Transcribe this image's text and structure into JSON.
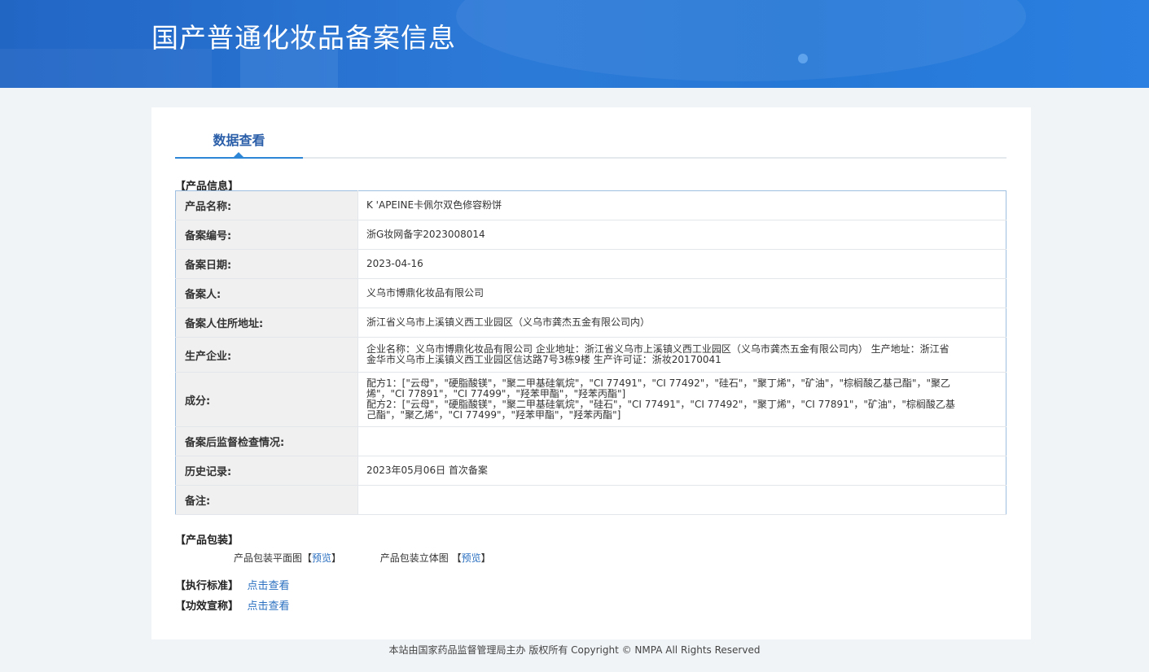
{
  "header": {
    "title": "国产普通化妆品备案信息"
  },
  "tabs": [
    {
      "label": "数据查看"
    }
  ],
  "product_info": {
    "section_label": "【产品信息】",
    "rows": [
      {
        "key": "产品名称:",
        "value": "K 'APEINE卡佩尔双色修容粉饼"
      },
      {
        "key": "备案编号:",
        "value": "浙G妆网备字2023008014"
      },
      {
        "key": "备案日期:",
        "value": "2023-04-16"
      },
      {
        "key": "备案人:",
        "value": "义乌市博鼎化妆品有限公司"
      },
      {
        "key": "备案人住所地址:",
        "value": "浙江省义乌市上溪镇义西工业园区（义乌市龚杰五金有限公司内）"
      },
      {
        "key": "生产企业:",
        "value": "企业名称：义乌市博鼎化妆品有限公司 企业地址：浙江省义乌市上溪镇义西工业园区（义乌市龚杰五金有限公司内） 生产地址：浙江省金华市义乌市上溪镇义西工业园区信达路7号3栋9楼 生产许可证：浙妆20170041"
      },
      {
        "key": "成分:",
        "value_lines": [
          "配方1：[\"云母\"，\"硬脂酸镁\"，\"聚二甲基硅氧烷\"，\"CI 77491\"，\"CI 77492\"，\"硅石\"，\"聚丁烯\"，\"矿油\"，\"棕榈酸乙基己酯\"，\"聚乙烯\"，\"CI 77891\"，\"CI 77499\"，\"羟苯甲酯\"，\"羟苯丙酯\"]",
          "配方2：[\"云母\"，\"硬脂酸镁\"，\"聚二甲基硅氧烷\"，\"硅石\"，\"CI 77491\"，\"CI 77492\"，\"聚丁烯\"，\"CI 77891\"，\"矿油\"，\"棕榈酸乙基己酯\"，\"聚乙烯\"，\"CI 77499\"，\"羟苯甲酯\"，\"羟苯丙酯\"]"
        ]
      },
      {
        "key": "备案后监督检查情况:",
        "value": ""
      },
      {
        "key": "历史记录:",
        "value": "2023年05月06日 首次备案"
      },
      {
        "key": "备注:",
        "value": ""
      }
    ]
  },
  "packaging": {
    "section_label": "【产品包装】",
    "flat_label": "产品包装平面图",
    "flat_bracket_open": "【",
    "flat_link": "预览",
    "flat_bracket_close": "】",
    "stereo_label": "产品包装立体图",
    "stereo_bracket_open": "【",
    "stereo_link": "预览",
    "stereo_bracket_close": "】"
  },
  "standard": {
    "label": "【执行标准】",
    "link": "点击查看"
  },
  "efficacy": {
    "label": "【功效宣称】",
    "link": "点击查看"
  },
  "footer": {
    "text": "本站由国家药品监督管理局主办 版权所有 Copyright © NMPA All Rights Reserved"
  }
}
